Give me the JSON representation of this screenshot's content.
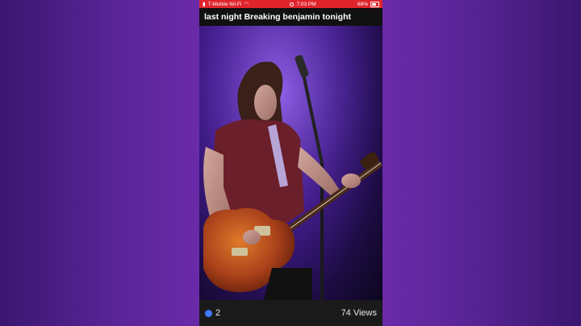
{
  "status_bar": {
    "carrier": "T-Mobile Wi-Fi",
    "time": "7:03 PM",
    "battery": "68%"
  },
  "post": {
    "caption": "last night Breaking benjamin tonight",
    "likes": "2",
    "views": "74 Views"
  },
  "colors": {
    "status_bar": "#e0242c",
    "background": "#4c1d86",
    "like_icon": "#3a7bff"
  },
  "icons": [
    "signal-icon",
    "wifi-icon",
    "record-icon",
    "battery-icon",
    "like-icon"
  ]
}
